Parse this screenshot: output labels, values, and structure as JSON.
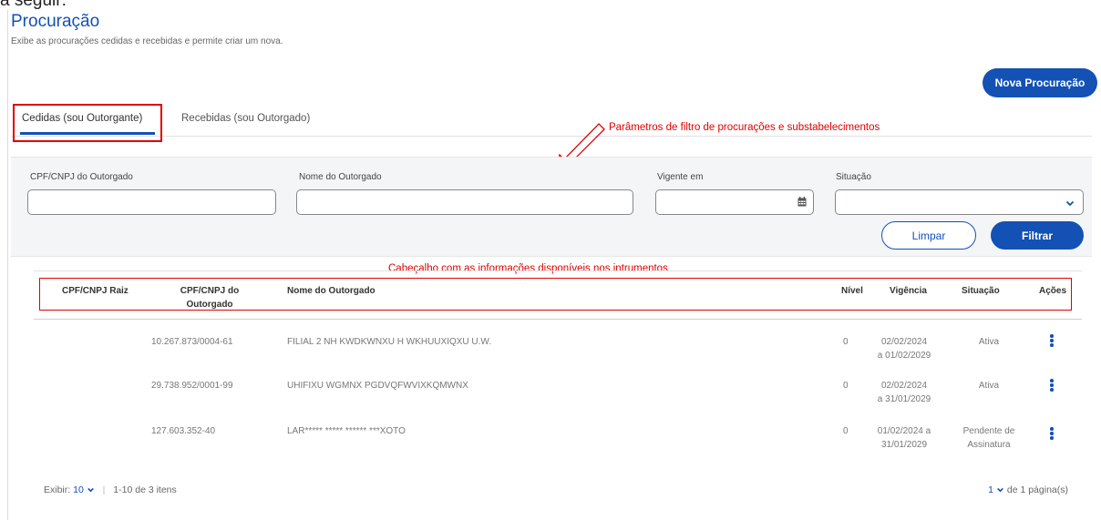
{
  "top_cropped_text": "a seguir:",
  "page": {
    "title": "Procuração",
    "subtitle": "Exibe as procurações cedidas e recebidas e permite criar um nova.",
    "new_button": "Nova Procuração"
  },
  "tabs": [
    {
      "label": "Cedidas (sou Outorgante)",
      "active": true
    },
    {
      "label": "Recebidas (sou Outorgado)",
      "active": false
    }
  ],
  "annotations": {
    "filters": "Parâmetros de filtro de procurações e substabelecimentos",
    "header": "Cabeçalho com as informações disponíveis nos intrumentos"
  },
  "filters": {
    "cpf_label": "CPF/CNPJ do Outorgado",
    "cpf_value": "",
    "nome_label": "Nome do Outorgado",
    "nome_value": "",
    "vigente_label": "Vigente em",
    "vigente_value": "",
    "situacao_label": "Situação",
    "situacao_value": "",
    "clear_button": "Limpar",
    "filter_button": "Filtrar"
  },
  "table": {
    "headers": {
      "cpf_raiz": "CPF/CNPJ Raiz",
      "cpf_outorgado_1": "CPF/CNPJ do",
      "cpf_outorgado_2": "Outorgado",
      "nome": "Nome do Outorgado",
      "nivel": "Nível",
      "vigencia": "Vigência",
      "situacao": "Situação",
      "acoes": "Ações"
    },
    "rows": [
      {
        "cpf_raiz": "",
        "cpf_outorgado": "10.267.873/0004-61",
        "nome": "FILIAL 2 NH KWDKWNXU H WKHUUXIQXU U.W.",
        "nivel": "0",
        "vigencia_1": "02/02/2024",
        "vigencia_2": "a 01/02/2029",
        "situacao_1": "Ativa",
        "situacao_2": ""
      },
      {
        "cpf_raiz": "",
        "cpf_outorgado": "29.738.952/0001-99",
        "nome": "UHIFIXU WGMNX PGDVQFWVIXKQMWNX",
        "nivel": "0",
        "vigencia_1": "02/02/2024",
        "vigencia_2": "a 31/01/2029",
        "situacao_1": "Ativa",
        "situacao_2": ""
      },
      {
        "cpf_raiz": "",
        "cpf_outorgado": "127.603.352-40",
        "nome": "LAR***** ***** ****** ***XOTO",
        "nivel": "0",
        "vigencia_1": "01/02/2024 a",
        "vigencia_2": "31/01/2029",
        "situacao_1": "Pendente de",
        "situacao_2": "Assinatura"
      }
    ]
  },
  "pagination": {
    "exibir_label": "Exibir:",
    "page_size": "10",
    "sep": "|",
    "range": "1-10 de 3 itens",
    "current_page": "1",
    "total_pages": "de 1 página(s)"
  },
  "colors": {
    "primary": "#1351b4",
    "annotation": "#e00000",
    "panel_bg": "#f4f5f7"
  }
}
